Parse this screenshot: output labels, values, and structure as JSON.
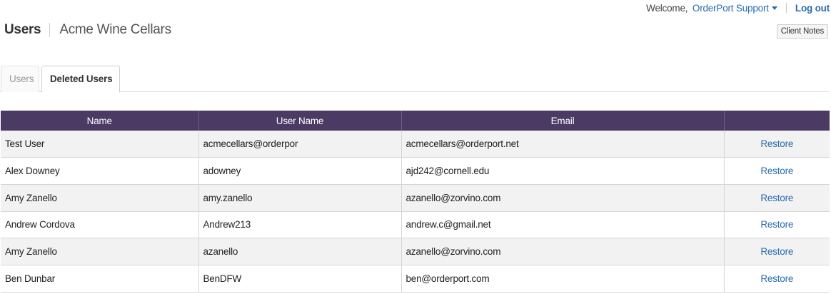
{
  "header": {
    "welcome": "Welcome,",
    "user_menu": "OrderPort Support",
    "logout": "Log out",
    "client_notes": "Client Notes",
    "page_title": "Users",
    "client_name": "Acme Wine Cellars"
  },
  "tabs": [
    {
      "label": "Users",
      "active": false
    },
    {
      "label": "Deleted Users",
      "active": true
    }
  ],
  "table": {
    "columns": [
      "Name",
      "User Name",
      "Email",
      ""
    ],
    "action_label": "Restore",
    "rows": [
      {
        "name": "Test User",
        "username": "acmecellars@orderpor",
        "email": "acmecellars@orderport.net"
      },
      {
        "name": "Alex Downey",
        "username": "adowney",
        "email": "ajd242@cornell.edu"
      },
      {
        "name": "Amy Zanello",
        "username": "amy.zanello",
        "email": "azanello@zorvino.com"
      },
      {
        "name": "Andrew Cordova",
        "username": "Andrew213",
        "email": "andrew.c@gmail.net"
      },
      {
        "name": "Amy Zanello",
        "username": "azanello",
        "email": "azanello@zorvino.com"
      },
      {
        "name": "Ben Dunbar",
        "username": "BenDFW",
        "email": "ben@orderport.com"
      }
    ]
  },
  "colors": {
    "header_bg": "#4a3a64",
    "link": "#2a6cb0",
    "row_alt": "#f2f2f2"
  }
}
